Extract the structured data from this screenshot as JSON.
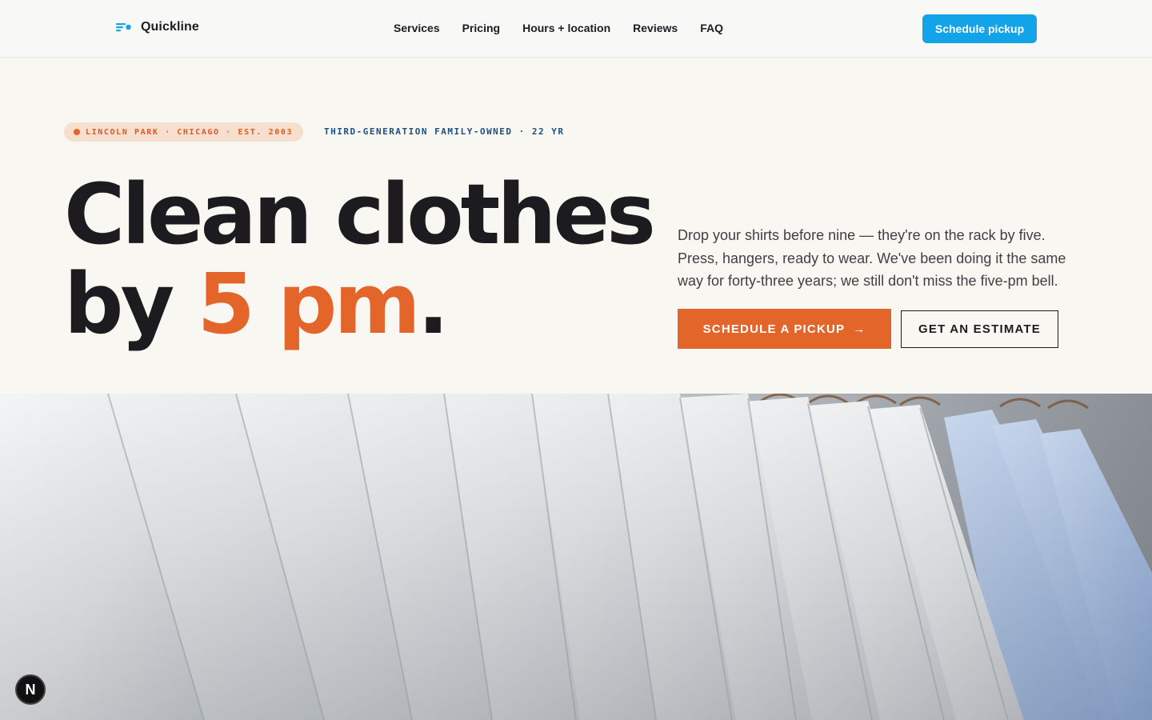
{
  "nav": {
    "brand": "Quickline",
    "links": [
      "Services",
      "Pricing",
      "Hours + location",
      "Reviews",
      "FAQ"
    ],
    "cta": "Schedule pickup"
  },
  "hero": {
    "location_tag": "LINCOLN PARK · CHICAGO · EST. 2003",
    "secondary_tag": "THIRD-GENERATION FAMILY-OWNED · 22 YR",
    "headline_line1": "Clean clothes",
    "headline_line2_prefix": "by ",
    "headline_accent": "5 pm",
    "headline_period": ".",
    "lede": "Drop your shirts before nine — they're on the rack by five. Press, hangers, ready to wear. We've been doing it the same way for forty-three years; we still don't miss the five-pm bell.",
    "primary_cta": "SCHEDULE A PICKUP",
    "primary_cta_arrow": "→",
    "secondary_cta": "GET AN ESTIMATE"
  },
  "devtools_badge": "N",
  "colors": {
    "accent": "#e4652a",
    "brand_blue": "#12a3e8",
    "background": "#f9f7f1",
    "text": "#1b1b20"
  },
  "icons": {
    "logo": "speed-lines-icon",
    "cta_arrow": "arrow-right-icon",
    "tag": "dot-icon"
  }
}
